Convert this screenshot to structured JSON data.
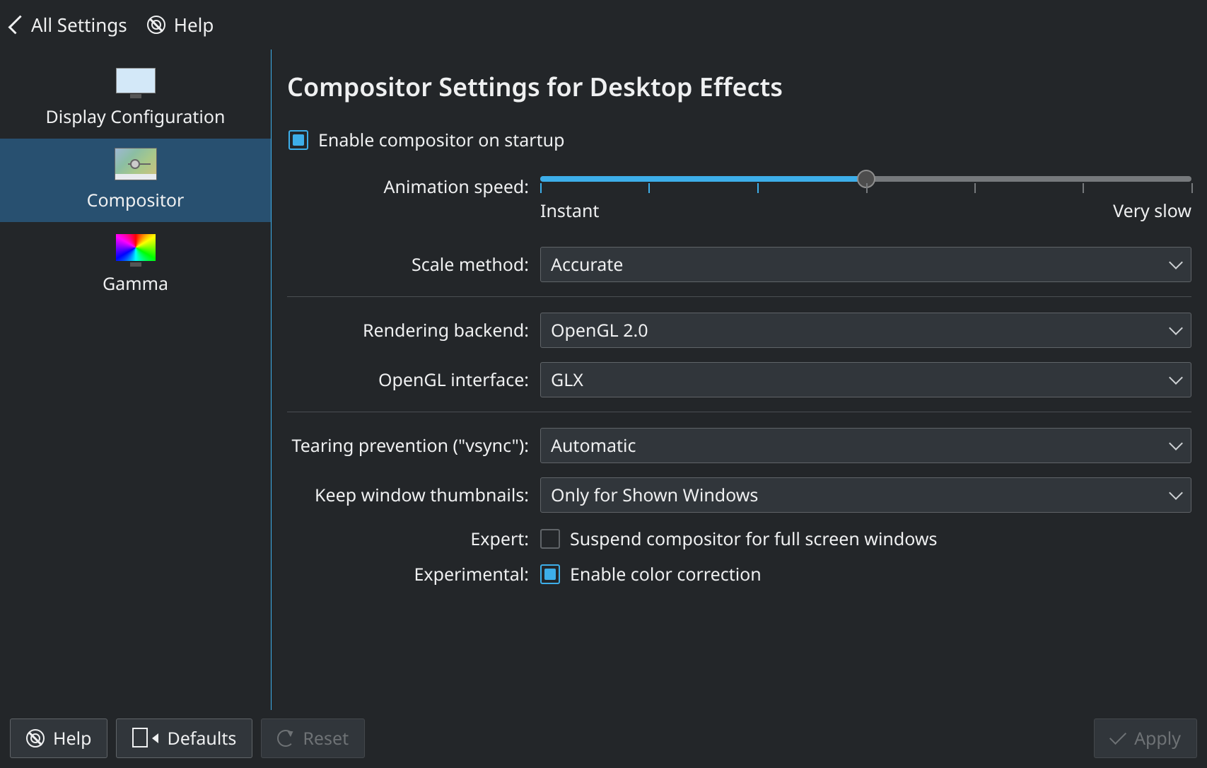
{
  "toolbar": {
    "all_settings": "All Settings",
    "help": "Help"
  },
  "sidebar": {
    "items": [
      {
        "label": "Display Configuration"
      },
      {
        "label": "Compositor"
      },
      {
        "label": "Gamma"
      }
    ],
    "selected_index": 1
  },
  "page": {
    "title": "Compositor Settings for Desktop Effects"
  },
  "form": {
    "enable_startup": {
      "label": "Enable compositor on startup",
      "checked": true
    },
    "animation_speed": {
      "label": "Animation speed:",
      "min_label": "Instant",
      "max_label": "Very slow",
      "value_percent": 50,
      "ticks": 7
    },
    "scale_method": {
      "label": "Scale method:",
      "value": "Accurate"
    },
    "rendering_backend": {
      "label": "Rendering backend:",
      "value": "OpenGL 2.0"
    },
    "opengl_interface": {
      "label": "OpenGL interface:",
      "value": "GLX"
    },
    "tearing_prevention": {
      "label": "Tearing prevention (\"vsync\"):",
      "value": "Automatic"
    },
    "keep_thumbnails": {
      "label": "Keep window thumbnails:",
      "value": "Only for Shown Windows"
    },
    "expert": {
      "label": "Expert:",
      "check_label": "Suspend compositor for full screen windows",
      "checked": false
    },
    "experimental": {
      "label": "Experimental:",
      "check_label": "Enable color correction",
      "checked": true
    }
  },
  "buttons": {
    "help": "Help",
    "defaults": "Defaults",
    "reset": "Reset",
    "apply": "Apply"
  }
}
